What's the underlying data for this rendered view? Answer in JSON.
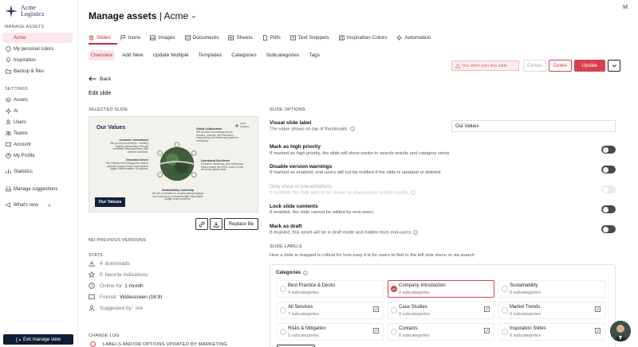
{
  "app": {
    "logo_line1": "Acme",
    "logo_line2": "Logistics",
    "user_initial": "M"
  },
  "sidebar": {
    "section_manage": "MANAGE ASSETS",
    "manage_items": [
      {
        "label": "Acme",
        "active": true
      },
      {
        "label": "My personal colors"
      },
      {
        "label": "Inspiration"
      },
      {
        "label": "Backup & files"
      }
    ],
    "section_settings": "SETTINGS",
    "settings_items": [
      {
        "label": "Assets"
      },
      {
        "label": "AI"
      },
      {
        "label": "Users"
      },
      {
        "label": "Teams"
      },
      {
        "label": "Account"
      },
      {
        "label": "My Profile"
      }
    ],
    "statistics": "Statistics",
    "manage_suggestions": "Manage suggestions",
    "whats_new": "What's new",
    "exit_label": "Exit manage view"
  },
  "header": {
    "title": "Manage assets",
    "workspace": "Acme"
  },
  "tabs": [
    "Slides",
    "Icons",
    "Images",
    "Documents",
    "Sheets",
    "Pdfs",
    "Text Snippets",
    "Inspiration Colors",
    "Automation"
  ],
  "subtabs": [
    "Overview",
    "Add New",
    "Update Multiple",
    "Templates",
    "Categories",
    "Subcategories",
    "Tags"
  ],
  "actions": {
    "warning": "You don't own this slide",
    "cancel": "Cancel",
    "delete": "Delete",
    "update": "Update"
  },
  "back": "Back",
  "edit_title": "Edit slide",
  "selected_slide": {
    "heading": "SELECTED SLIDE",
    "slide_title": "Our Values",
    "chip": "Our Values",
    "logo": "Acme Logistics",
    "texts": [
      {
        "title": "Customer Commitment",
        "body": "We go beyond delivery - building lasting partnerships through reliability, responsiveness, and tailored solutions."
      },
      {
        "title": "Global Collaboration",
        "body": "We succeed by working across borders, cultures, and functions - empowering our teams and partners worldwide."
      },
      {
        "title": "Innovation Driven",
        "body": "We embrace technology and data to optimize supply chains and lead the digital transformation of logistics."
      },
      {
        "title": "Operational Excellence",
        "body": "Precision, efficiency, and continuous improvement are at the heart of how we move global trade."
      },
      {
        "title": "Sustainability Leadership",
        "body": "We are committed to decarbonizing logistics and advancing environmentally responsible supply chain solutions."
      }
    ],
    "replace": "Replace file"
  },
  "previous_versions": "NO PREVIOUS VERSIONS",
  "stats": {
    "heading": "STATS",
    "downloads_value": "4",
    "downloads_label": "downloads",
    "favorites_value": "0",
    "favorites_label": "favorite indications",
    "online_label": "Online for",
    "online_value": "1 month",
    "format_label": "Format:",
    "format_value": "Widescreen (16:9)",
    "suggested_label": "Suggested by:",
    "suggested_value": "n/a"
  },
  "changelog": {
    "heading": "CHANGE LOG",
    "entry": "LABELS AND/OR OPTIONS UPDATED BY MARKETING"
  },
  "options": {
    "heading": "SLIDE OPTIONS",
    "label_title": "Visual slide label",
    "label_desc": "The value shows on top of thumbnails.",
    "label_value": "Our Values",
    "items": [
      {
        "title": "Mark as high priority",
        "desc": "If marked as high priority, the slide will show earlier in search results and category views",
        "disabled": false
      },
      {
        "title": "Disable version warnings",
        "desc": "If marked as enabled, end-users will not be notified if the slide is updated or deleted.",
        "disabled": false
      },
      {
        "title": "Only show in presentations",
        "desc": "If enabled, the slide will not be shown as stand-alone search results.",
        "disabled": true
      },
      {
        "title": "Lock slide contents",
        "desc": "If enabled, the slide cannot be edited by end-users.",
        "disabled": false
      },
      {
        "title": "Mark as draft",
        "desc": "If enabled, this asset will be in draft mode and hidden from end-users.",
        "disabled": false
      }
    ]
  },
  "labels": {
    "heading": "SLIDE LABELS",
    "desc": "How a slide is mapped is critical for how easy it is for users to find in the left side menu or via search",
    "categories_label": "Categories",
    "categories": [
      {
        "name": "Best Practice & Decks",
        "sub": "0 subcategories",
        "selected": false,
        "editable": false
      },
      {
        "name": "Company Introduction",
        "sub": "0 subcategories",
        "selected": true,
        "editable": false
      },
      {
        "name": "Sustainability",
        "sub": "0 subcategories",
        "selected": false,
        "editable": false
      },
      {
        "name": "All Services",
        "sub": "7 subcategories",
        "selected": false,
        "editable": true
      },
      {
        "name": "Case Studies",
        "sub": "0 subcategories",
        "selected": false,
        "editable": true
      },
      {
        "name": "Market Trends",
        "sub": "0 subcategories",
        "selected": false,
        "editable": true
      },
      {
        "name": "Risks & Mitigation",
        "sub": "5 subcategories",
        "selected": false,
        "editable": true
      },
      {
        "name": "Contacts",
        "sub": "0 subcategories",
        "selected": false,
        "editable": true
      },
      {
        "name": "Inspiration Slides",
        "sub": "6 subcategories",
        "selected": false,
        "editable": true
      }
    ]
  },
  "colors": {
    "accent": "#d6404f",
    "navy": "#0e1f33"
  }
}
